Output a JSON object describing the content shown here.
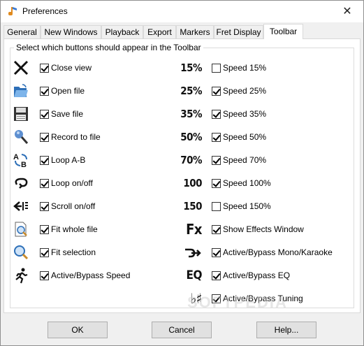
{
  "window": {
    "title": "Preferences",
    "close_glyph": "✕",
    "app_icon": "music-note-icon"
  },
  "tabs": [
    "General",
    "New Windows",
    "Playback",
    "Export",
    "Markers",
    "Fret Display",
    "Toolbar"
  ],
  "active_tab": "Toolbar",
  "group": {
    "legend": "Select which buttons should appear in the Toolbar"
  },
  "left_items": [
    {
      "label": "Close view",
      "checked": true,
      "icon": "close-view-icon"
    },
    {
      "label": "Open file",
      "checked": true,
      "icon": "open-folder-icon"
    },
    {
      "label": "Save file",
      "checked": true,
      "icon": "save-floppy-icon"
    },
    {
      "label": "Record to file",
      "checked": true,
      "icon": "microphone-icon"
    },
    {
      "label": "Loop A-B",
      "checked": true,
      "icon": "loop-ab-icon"
    },
    {
      "label": "Loop on/off",
      "checked": true,
      "icon": "loop-icon"
    },
    {
      "label": "Scroll on/off",
      "checked": true,
      "icon": "scroll-icon"
    },
    {
      "label": "Fit whole file",
      "checked": true,
      "icon": "fit-file-icon"
    },
    {
      "label": "Fit selection",
      "checked": true,
      "icon": "fit-selection-icon"
    },
    {
      "label": "Active/Bypass Speed",
      "checked": true,
      "icon": "running-man-icon"
    }
  ],
  "right_items": [
    {
      "icon_text": "15%",
      "label": "Speed 15%",
      "checked": false
    },
    {
      "icon_text": "25%",
      "label": "Speed 25%",
      "checked": true
    },
    {
      "icon_text": "35%",
      "label": "Speed 35%",
      "checked": true
    },
    {
      "icon_text": "50%",
      "label": "Speed 50%",
      "checked": true
    },
    {
      "icon_text": "70%",
      "label": "Speed 70%",
      "checked": true
    },
    {
      "icon_text": "100",
      "label": "Speed 100%",
      "checked": true
    },
    {
      "icon_text": "150",
      "label": "Speed 150%",
      "checked": false
    },
    {
      "icon_text": "Fx",
      "label": "Show Effects Window",
      "checked": true
    },
    {
      "icon_text": "",
      "label": "Active/Bypass Mono/Karaoke",
      "checked": true,
      "icon": "mono-karaoke-icon"
    },
    {
      "icon_text": "EQ",
      "label": "Active/Bypass EQ",
      "checked": true
    },
    {
      "icon_text": "♭♯",
      "label": "Active/Bypass Tuning",
      "checked": true
    }
  ],
  "buttons": {
    "ok": "OK",
    "cancel": "Cancel",
    "help": "Help..."
  },
  "watermark": "SOFTPEDIA"
}
